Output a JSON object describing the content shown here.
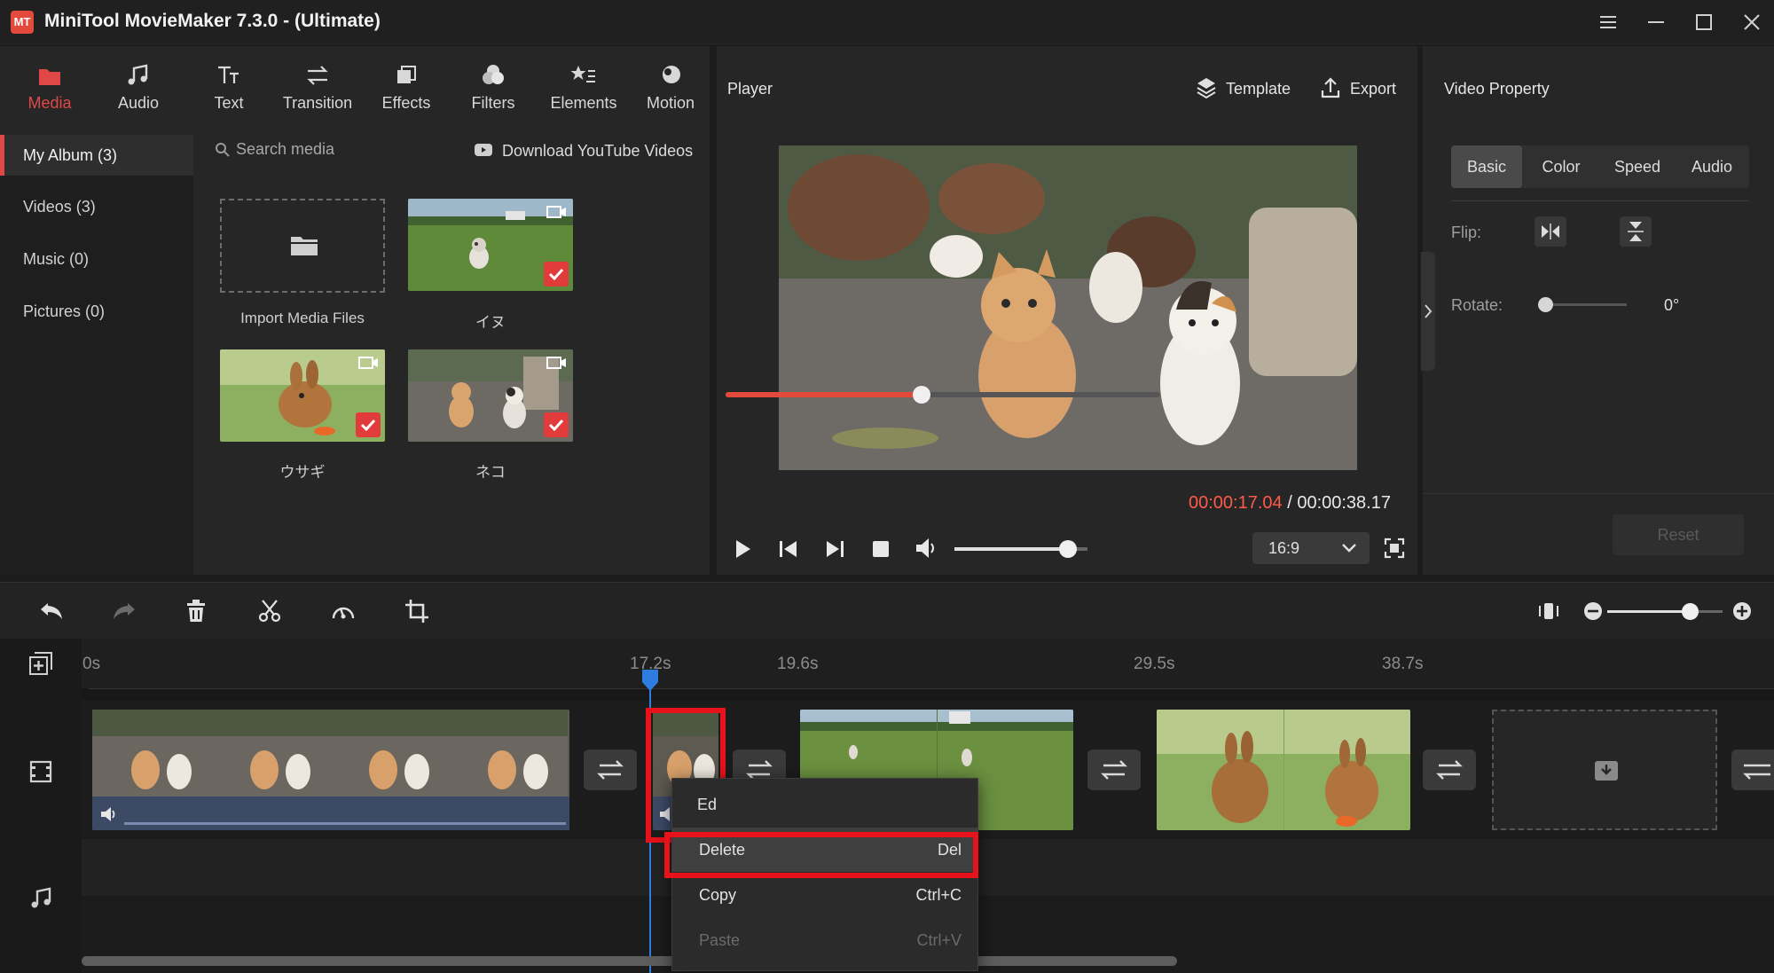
{
  "window": {
    "title": "MiniTool MovieMaker 7.3.0 - (Ultimate)",
    "logo_text": "MT",
    "controls": [
      "menu-icon",
      "minimize-icon",
      "maximize-icon",
      "close-icon"
    ]
  },
  "toolbar": {
    "items": [
      {
        "label": "Media",
        "icon": "folder-icon",
        "active": true
      },
      {
        "label": "Audio",
        "icon": "music-note-icon"
      },
      {
        "label": "Text",
        "icon": "text-icon"
      },
      {
        "label": "Transition",
        "icon": "swap-arrows-icon"
      },
      {
        "label": "Effects",
        "icon": "effects-icon"
      },
      {
        "label": "Filters",
        "icon": "filters-icon"
      },
      {
        "label": "Elements",
        "icon": "elements-icon"
      },
      {
        "label": "Motion",
        "icon": "motion-icon"
      }
    ]
  },
  "sidebar": {
    "items": [
      {
        "label": "My Album (3)",
        "active": true
      },
      {
        "label": "Videos (3)"
      },
      {
        "label": "Music (0)"
      },
      {
        "label": "Pictures (0)"
      }
    ]
  },
  "media": {
    "search_placeholder": "Search media",
    "download_label": "Download YouTube Videos",
    "import_label": "Import Media Files",
    "files": [
      {
        "label": "イヌ",
        "scene": "dog"
      },
      {
        "label": "ウサギ",
        "scene": "rabbit"
      },
      {
        "label": "ネコ",
        "scene": "cats"
      }
    ]
  },
  "player": {
    "title": "Player",
    "template_label": "Template",
    "export_label": "Export",
    "current_time": "00:00:17.04",
    "separator": " / ",
    "total_time": "00:00:38.17",
    "progress": 0.45,
    "volume": 0.85,
    "aspect_ratio": "16:9"
  },
  "property": {
    "title": "Video Property",
    "tabs": [
      "Basic",
      "Color",
      "Speed",
      "Audio"
    ],
    "active_tab": "Basic",
    "flip_label": "Flip:",
    "rotate_label": "Rotate:",
    "rotate_value": "0°",
    "reset_label": "Reset"
  },
  "timeline": {
    "ruler": [
      "0s",
      "17.2s",
      "19.6s",
      "29.5s",
      "38.7s"
    ],
    "zoom": 0.72
  },
  "context_menu": {
    "items": [
      {
        "label": "Ed",
        "shortcut": ""
      },
      {
        "label": "Delete",
        "shortcut": "Del"
      },
      {
        "label": "Copy",
        "shortcut": "Ctrl+C"
      },
      {
        "label": "Paste",
        "shortcut": "Ctrl+V",
        "disabled": true
      }
    ]
  },
  "colors": {
    "accent": "#e04848",
    "time_current": "#ff5a4a",
    "playhead": "#2f7de0",
    "highlight": "#e8121a"
  }
}
